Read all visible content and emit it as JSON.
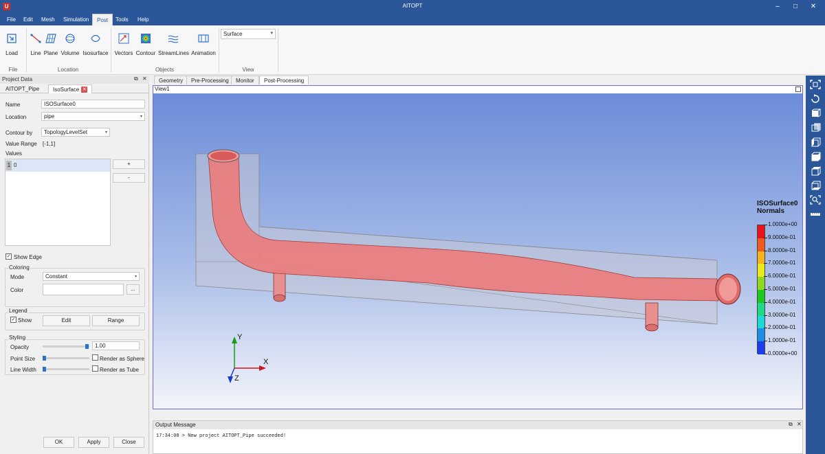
{
  "app": {
    "title": "AITOPT",
    "icon_letter": "U"
  },
  "window_controls": {
    "minimize": "–",
    "maximize": "□",
    "close": "✕"
  },
  "menu": [
    "File",
    "Edit",
    "Mesh",
    "Simulation",
    "Post",
    "Tools",
    "Help"
  ],
  "menu_active": "Post",
  "ribbon": {
    "buttons": [
      {
        "label": "Load",
        "icon": "load-icon"
      },
      {
        "label": "Line",
        "icon": "line-icon"
      },
      {
        "label": "Plane",
        "icon": "plane-icon"
      },
      {
        "label": "Volume",
        "icon": "volume-icon"
      },
      {
        "label": "Isosurface",
        "icon": "isosurface-icon"
      },
      {
        "label": "Vectors",
        "icon": "vectors-icon"
      },
      {
        "label": "Contour",
        "icon": "contour-icon"
      },
      {
        "label": "StreamLines",
        "icon": "streamlines-icon"
      },
      {
        "label": "Animation",
        "icon": "animation-icon"
      }
    ],
    "groups": {
      "file": "File",
      "location": "Location",
      "objects": "Objects",
      "view": "View"
    },
    "view_select": "Surface"
  },
  "left_panel": {
    "header": "Project Data",
    "tabs": [
      "AITOPT_Pipe",
      "IsoSurface"
    ],
    "name_label": "Name",
    "name_value": "ISOSurface0",
    "location_label": "Location",
    "location_value": "pipe",
    "contour_by_label": "Contour by",
    "contour_by_value": "TopologyLevelSet",
    "value_range_label": "Value Range",
    "value_range_value": "[-1,1]",
    "values_label": "Values",
    "values_list": [
      {
        "index": "1",
        "value": "0"
      }
    ],
    "add_button": "+",
    "remove_button": "-",
    "show_edge_label": "Show Edge",
    "show_edge_checked": true,
    "coloring": {
      "title": "Coloring",
      "mode_label": "Mode",
      "mode_value": "Constant",
      "color_label": "Color",
      "color_button": "..."
    },
    "legend": {
      "title": "Legend",
      "show_label": "Show",
      "show_checked": true,
      "edit_button": "Edit",
      "range_button": "Range"
    },
    "styling": {
      "title": "Styling",
      "opacity_label": "Opacity",
      "opacity_value": "1.00",
      "point_size_label": "Point Size",
      "render_sphere_label": "Render as Sphere",
      "line_width_label": "Line Width",
      "render_tube_label": "Render as Tube"
    },
    "footer": {
      "ok": "OK",
      "apply": "Apply",
      "close": "Close"
    }
  },
  "workspace": {
    "tabs": [
      "Geometry",
      "Pre-Processing",
      "Monitor",
      "Post-Processing"
    ],
    "active_tab": "Post-Processing",
    "view_title": "View1"
  },
  "axes": {
    "x": "X",
    "y": "Y",
    "z": "Z"
  },
  "legend": {
    "title_line1": "ISOSurface0",
    "title_line2": "Normals",
    "labels": [
      "1.0000e+00",
      "9.0000e-01",
      "8.0000e-01",
      "7.0000e-01",
      "6.0000e-01",
      "5.0000e-01",
      "4.0000e-01",
      "3.0000e-01",
      "2.0000e-01",
      "1.0000e-01",
      "0.0000e+00"
    ],
    "colors": [
      "#e8141a",
      "#f05a1c",
      "#f7b21e",
      "#e8e81e",
      "#8fd81e",
      "#1ec81e",
      "#1ed889",
      "#1ed8d8",
      "#1e8fe8",
      "#1e3ee8",
      "#1a14d8"
    ]
  },
  "output": {
    "title": "Output Message",
    "lines": [
      "17:34:08 > New project AITOPT_Pipe succeeded!"
    ]
  },
  "right_toolbar": [
    "fit-view-icon",
    "rotate-icon",
    "view-front-icon",
    "view-back-icon",
    "view-left-icon",
    "view-right-icon",
    "view-top-icon",
    "view-bottom-icon",
    "zoom-icon",
    "ruler-icon"
  ]
}
